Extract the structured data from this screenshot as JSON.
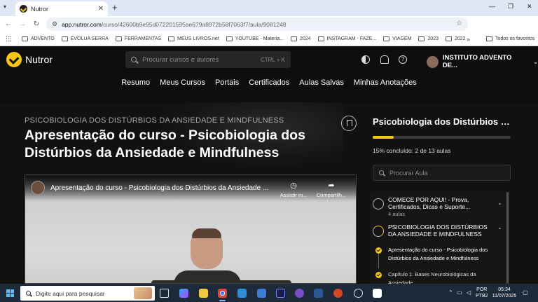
{
  "browser": {
    "tab_title": "Nutror",
    "tab_close": "✕",
    "new_tab": "+",
    "url_host": "app.nutror.com",
    "url_path": "/curso/42600b9e95d072201595ae679a8972b58f7063f7/aula/9081248",
    "bookmarks": [
      "ADVENTO",
      "EVOLUA SERRA",
      "FERRAMENTAS",
      "MEUS LIVROS.net",
      "YOUTUBE - Materia...",
      "2024",
      "INSTAGRAM - FAZE...",
      "VIAGEM",
      "2023",
      "2022"
    ],
    "bookmarks_more": "»",
    "bookmarks_all": "Todos os favoritos"
  },
  "site": {
    "brand": "Nutror",
    "search_placeholder": "Procurar cursos e autores",
    "search_shortcut": "CTRL + K",
    "help_glyph": "?",
    "user_name": "INSTITUTO ADVENTO DE...",
    "nav": [
      "Resumo",
      "Meus Cursos",
      "Portais",
      "Certificados",
      "Aulas Salvas",
      "Minhas Anotações"
    ]
  },
  "lesson": {
    "course_name": "PSICOBIOLOGIA DOS DISTÚRBIOS DA ANSIEDADE E MINDFULNESS",
    "title": "Apresentação do curso - Psicobiologia dos Distúrbios da Ansiedade e Mindfulness"
  },
  "video": {
    "title": "Apresentação do curso - Psicobiologia dos Distúrbios da Ansiedade ...",
    "watch_later": "Assistir m...",
    "share": "Compartilh..."
  },
  "sidebar": {
    "course_title": "Psicobiologia dos Distúrbios d...",
    "progress_fraction": 0.15,
    "progress_text": "15% concluído: 2 de 13 aulas",
    "search_placeholder": "Procurar Aula",
    "modules": [
      {
        "title": "COMECE POR AQUI! - Prova, Certificados, Dicas e Suporte...",
        "subtitle": "4 aulas",
        "expanded": false
      },
      {
        "title": "PSICOBIOLOGIA DOS DISTÚRBIOS DA ANSIEDADE E MINDFULNESS",
        "subtitle": "",
        "expanded": true
      }
    ],
    "lessons": [
      {
        "title": "Apresentação do curso - Psicobiologia dos Distúrbios da Ansiedade e Mindfulness",
        "completed": true
      },
      {
        "title": "Capítulo 1: Bases Neurobiológicas da Ansiedade",
        "completed": true
      }
    ]
  },
  "taskbar": {
    "search_placeholder": "Digite aqui para pesquisar",
    "lang_line1": "POR",
    "lang_line2": "PTB2",
    "time": "05:34",
    "date": "11/07/2025"
  },
  "colors": {
    "accent": "#f5c518",
    "background": "#0e0e10"
  }
}
